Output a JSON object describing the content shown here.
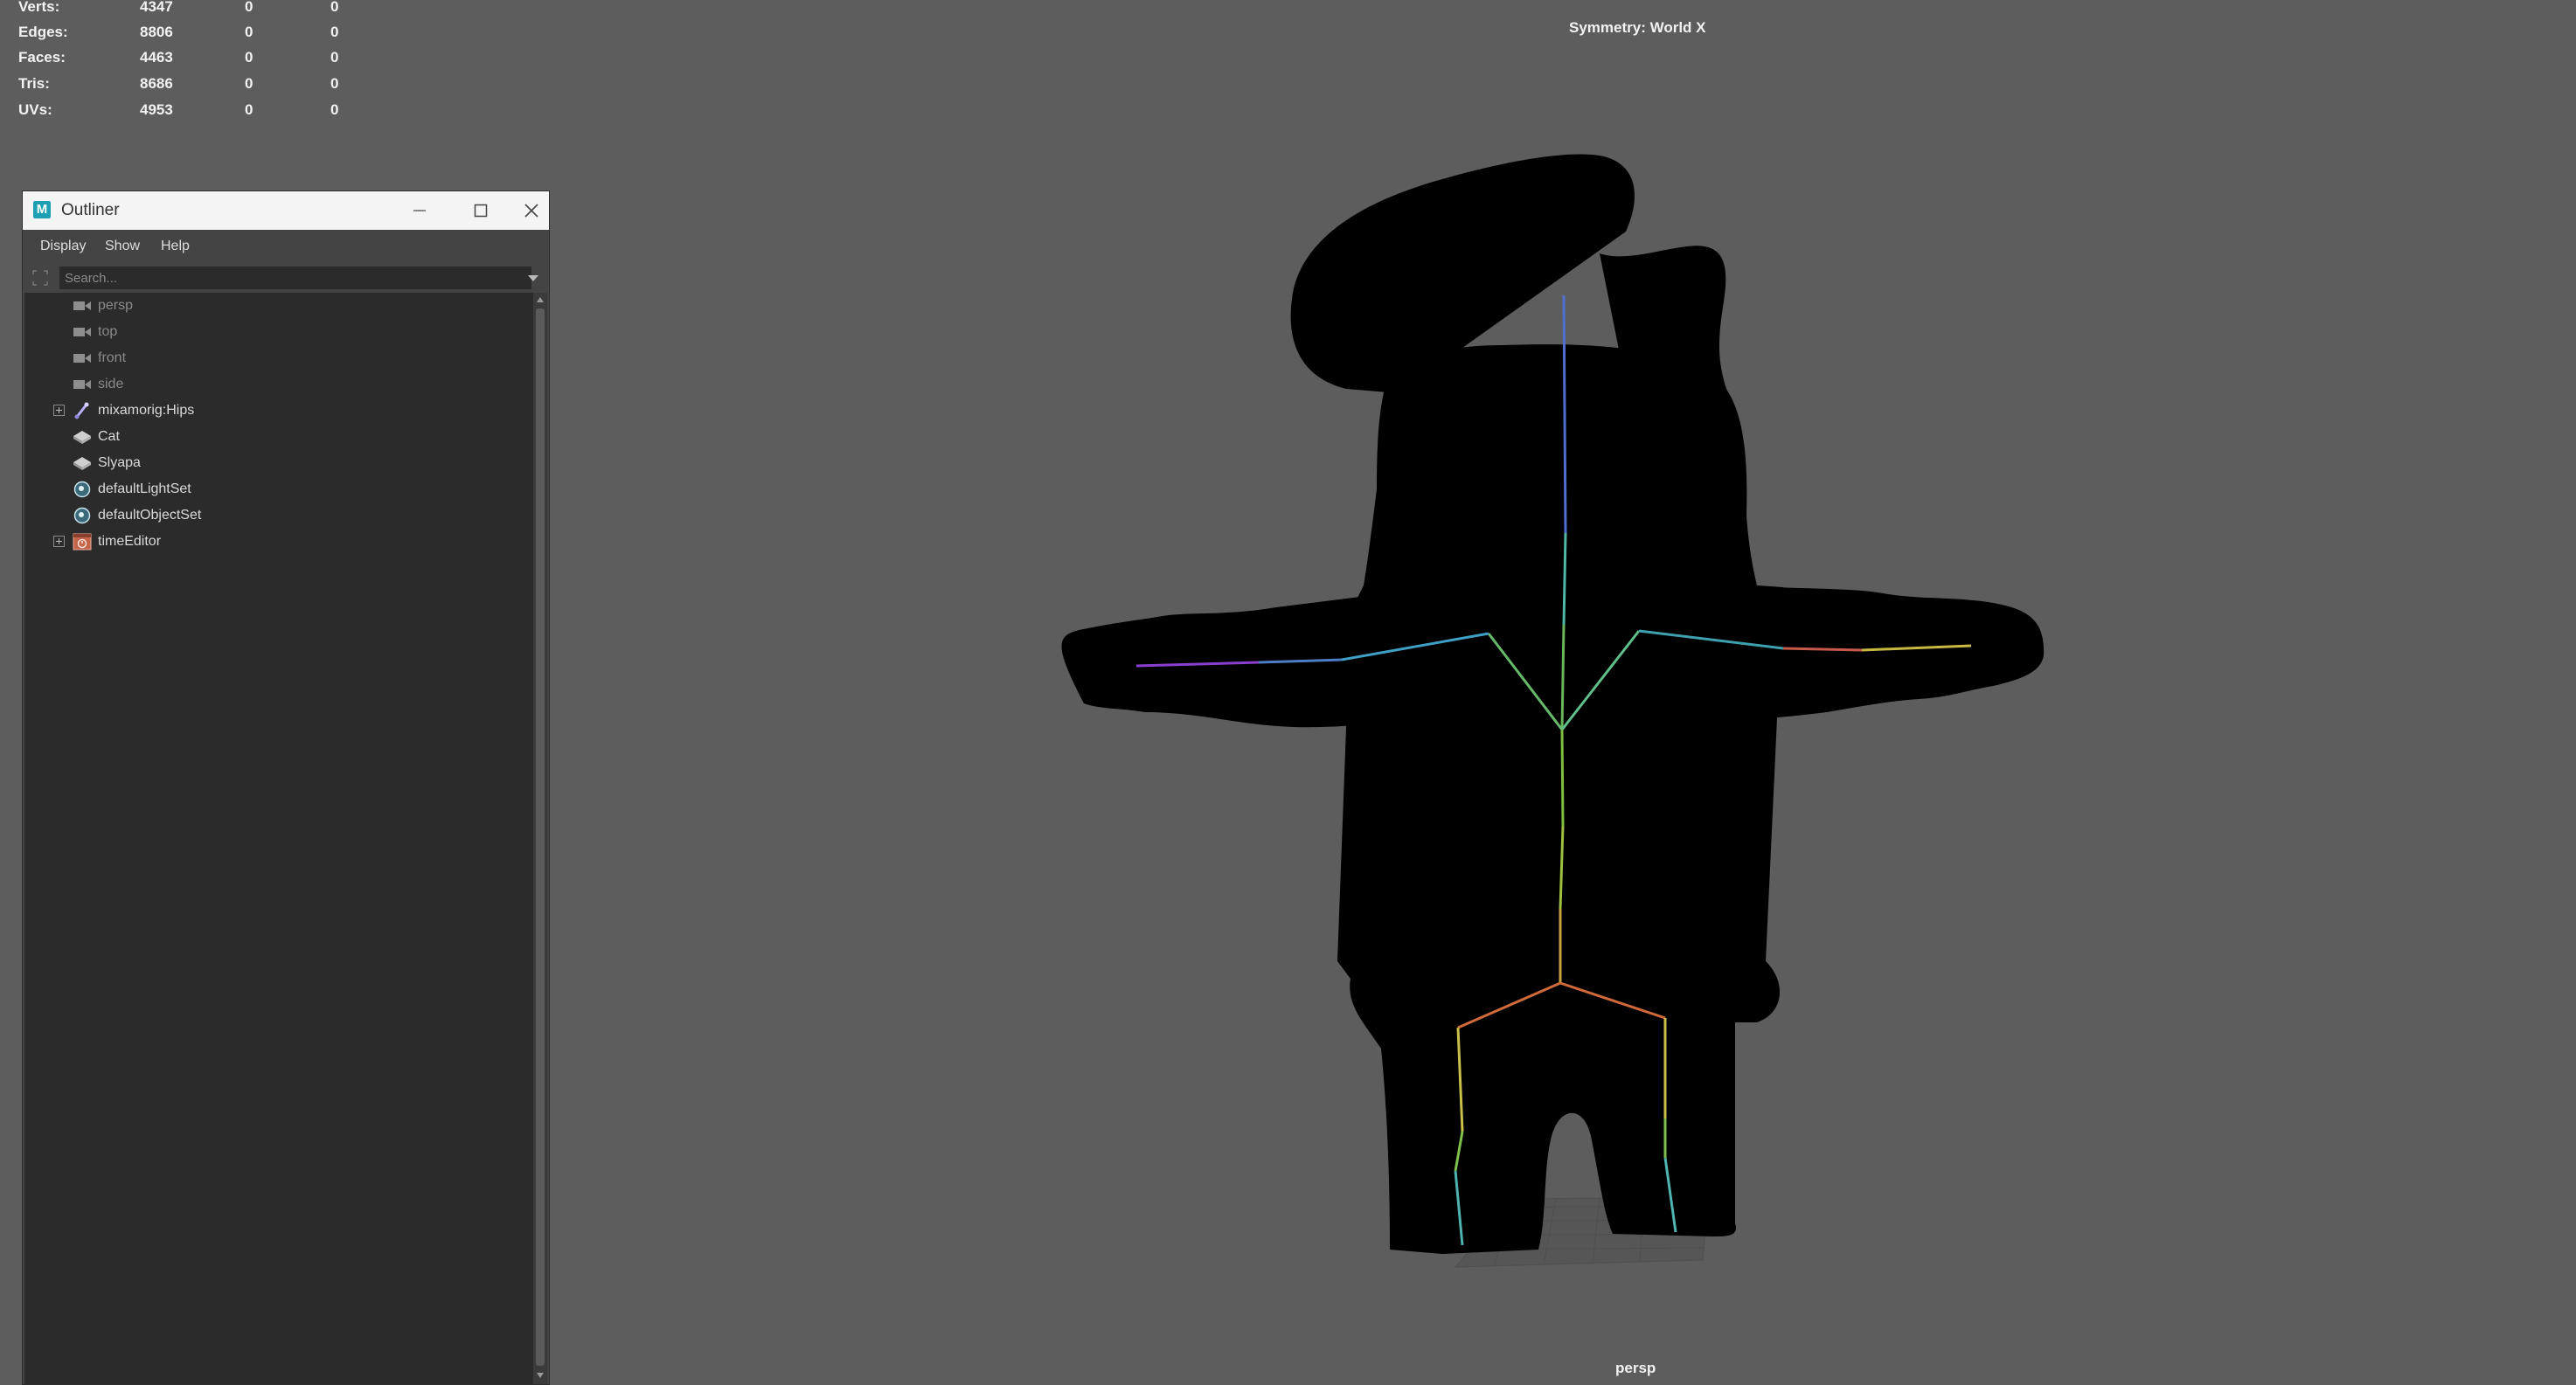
{
  "hud": {
    "rows": [
      {
        "label": "Verts:",
        "v1": "4347",
        "v2": "0",
        "v3": "0"
      },
      {
        "label": "Edges:",
        "v1": "8806",
        "v2": "0",
        "v3": "0"
      },
      {
        "label": "Faces:",
        "v1": "4463",
        "v2": "0",
        "v3": "0"
      },
      {
        "label": "Tris:",
        "v1": "8686",
        "v2": "0",
        "v3": "0"
      },
      {
        "label": "UVs:",
        "v1": "4953",
        "v2": "0",
        "v3": "0"
      }
    ],
    "symmetry": "Symmetry: World X",
    "camera": "persp"
  },
  "outliner": {
    "logo": "M",
    "title": "Outliner",
    "menu": {
      "display": "Display",
      "show": "Show",
      "help": "Help"
    },
    "search_placeholder": "Search...",
    "items": [
      {
        "label": "persp",
        "icon": "camera-icon",
        "hidden": true
      },
      {
        "label": "top",
        "icon": "camera-icon",
        "hidden": true
      },
      {
        "label": "front",
        "icon": "camera-icon",
        "hidden": true
      },
      {
        "label": "side",
        "icon": "camera-icon",
        "hidden": true
      },
      {
        "label": "mixamorig:Hips",
        "icon": "joint-icon",
        "expandable": true
      },
      {
        "label": "Cat",
        "icon": "mesh-icon"
      },
      {
        "label": "Slyapa",
        "icon": "mesh-icon"
      },
      {
        "label": "defaultLightSet",
        "icon": "set-icon"
      },
      {
        "label": "defaultObjectSet",
        "icon": "set-icon"
      },
      {
        "label": "timeEditor",
        "icon": "time-editor-icon",
        "expandable": true
      }
    ]
  },
  "colors": {
    "viewport_bg": "#5d5d5d",
    "accent": "#1ca1b3"
  }
}
